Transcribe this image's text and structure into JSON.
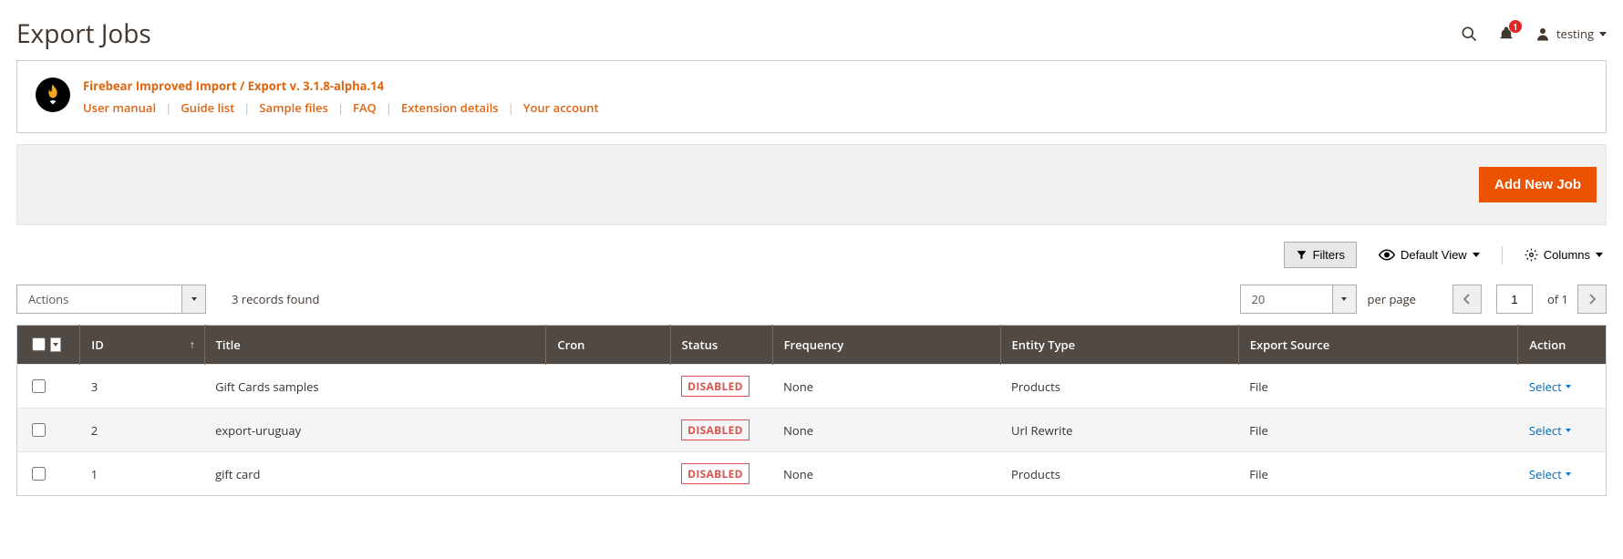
{
  "header": {
    "title": "Export Jobs",
    "notif_count": "1",
    "user_name": "testing"
  },
  "banner": {
    "product": "Firebear Improved Import / Export v. 3.1.8-alpha.14",
    "links": [
      "User manual",
      "Guide list",
      "Sample files",
      "FAQ",
      "Extension details",
      "Your account"
    ]
  },
  "actions": {
    "add_new": "Add New Job"
  },
  "toolbar": {
    "filters": "Filters",
    "default_view": "Default View",
    "columns": "Columns",
    "actions_label": "Actions",
    "records_found": "3 records found",
    "per_page_value": "20",
    "per_page_label": "per page",
    "page_current": "1",
    "page_total_label": "of 1"
  },
  "columns": {
    "id": "ID",
    "title": "Title",
    "cron": "Cron",
    "status": "Status",
    "frequency": "Frequency",
    "entity": "Entity Type",
    "source": "Export Source",
    "action": "Action"
  },
  "status_text": "DISABLED",
  "row_action": "Select",
  "rows": [
    {
      "id": "3",
      "title": "Gift Cards samples",
      "cron": "",
      "status": "DISABLED",
      "frequency": "None",
      "entity": "Products",
      "source": "File"
    },
    {
      "id": "2",
      "title": "export-uruguay",
      "cron": "",
      "status": "DISABLED",
      "frequency": "None",
      "entity": "Url Rewrite",
      "source": "File"
    },
    {
      "id": "1",
      "title": "gift card",
      "cron": "",
      "status": "DISABLED",
      "frequency": "None",
      "entity": "Products",
      "source": "File"
    }
  ]
}
